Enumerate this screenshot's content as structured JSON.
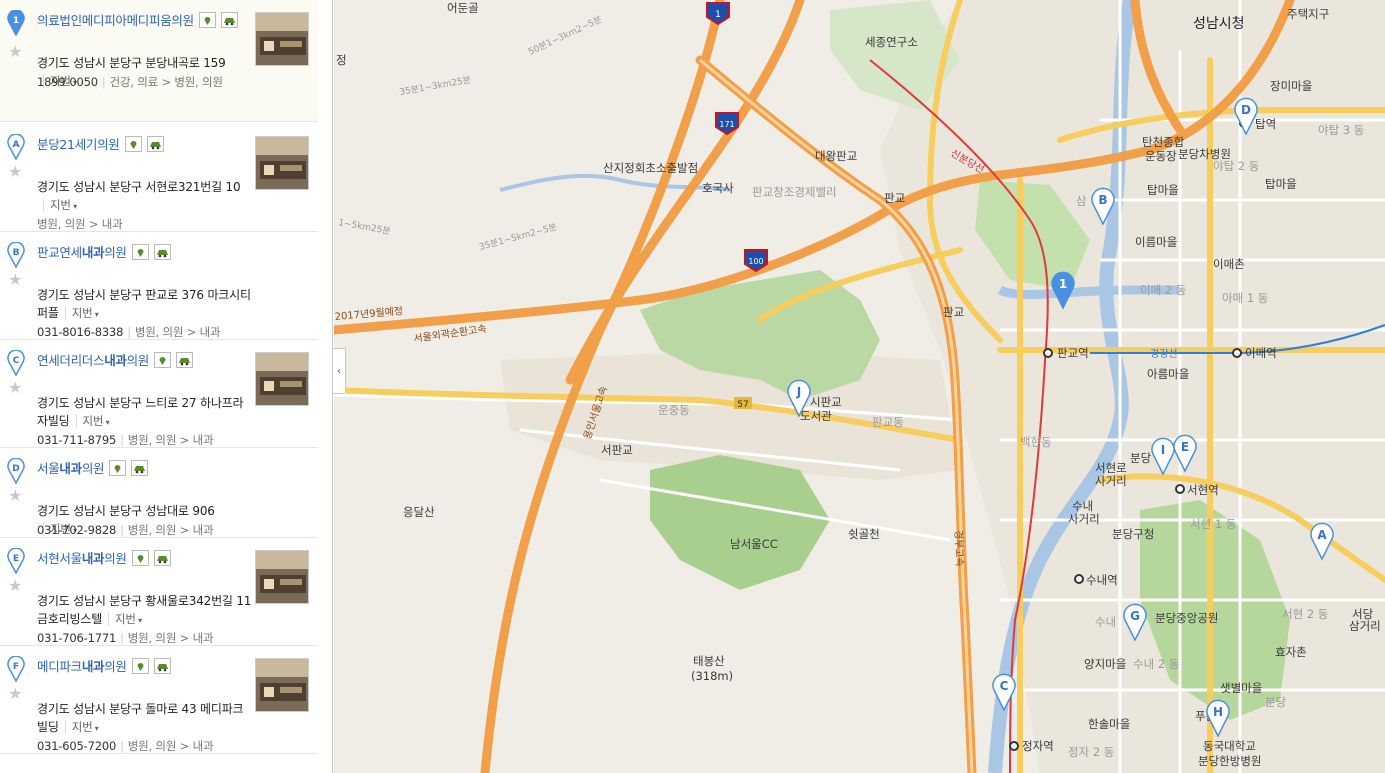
{
  "results": [
    {
      "marker": "1",
      "name": "의료법인메디피아메디피움의원",
      "name_pre": "",
      "name_bold": "",
      "name_post": "",
      "address": "경기도 성남시 분당구 분당내곡로 159",
      "jibeon": "지번",
      "phone": "1899-0050",
      "category": "건강, 의료",
      "subcategory": "병원, 의원",
      "active": true
    },
    {
      "marker": "A",
      "name": "",
      "name_pre": "분당21세기의원",
      "name_bold": "",
      "name_post": "",
      "address": "경기도 성남시 분당구 서현로321번길 10",
      "jibeon": "지번",
      "phone": "",
      "category": "병원, 의원",
      "subcategory": "내과"
    },
    {
      "marker": "B",
      "name": "",
      "name_pre": "판교연세",
      "name_bold": "내과",
      "name_post": "의원",
      "address": "경기도 성남시 분당구 판교로 376 마크시티 퍼플",
      "jibeon": "지번",
      "phone": "031-8016-8338",
      "category": "병원, 의원",
      "subcategory": "내과"
    },
    {
      "marker": "C",
      "name": "",
      "name_pre": "연세더리더스",
      "name_bold": "내과",
      "name_post": "의원",
      "address": "경기도 성남시 분당구 느티로 27 하나프라자빌딩",
      "jibeon": "지번",
      "phone": "031-711-8795",
      "category": "병원, 의원",
      "subcategory": "내과"
    },
    {
      "marker": "D",
      "name": "",
      "name_pre": "서울",
      "name_bold": "내과",
      "name_post": "의원",
      "address": "경기도 성남시 분당구 성남대로 906",
      "jibeon": "지번",
      "phone": "031-702-9828",
      "category": "병원, 의원",
      "subcategory": "내과"
    },
    {
      "marker": "E",
      "name": "",
      "name_pre": "서현서울",
      "name_bold": "내과",
      "name_post": "의원",
      "address": "경기도 성남시 분당구 황새울로342번길 11 금호리빙스텔",
      "jibeon": "지번",
      "phone": "031-706-1771",
      "category": "병원, 의원",
      "subcategory": "내과"
    },
    {
      "marker": "F",
      "name": "",
      "name_pre": "메디파크",
      "name_bold": "내과",
      "name_post": "의원",
      "address": "경기도 성남시 분당구 돌마로 43 메디파크빌딩",
      "jibeon": "지번",
      "phone": "031-605-7200",
      "category": "병원, 의원",
      "subcategory": "내과"
    }
  ],
  "ui": {
    "collapse_arrow": "‹",
    "star": "★"
  },
  "map": {
    "labels": {
      "seongnam_cityhall": "성남시청",
      "judaegu": "주택지구",
      "sejong": "세종연구소",
      "jangmi": "장미마을",
      "tapyeok": "탑역",
      "yatap3": "야탑 3 동",
      "tancheon": "탄천종합",
      "undongjang": "운동장",
      "bundang_cha": "분당차병원",
      "yatap2": "야탑 2 동",
      "tapmaeul": "탑마을",
      "tapmaeul2": "탑마을",
      "sam": "삼",
      "ireum": "이름마을",
      "imae": "이매촌",
      "imae2": "이매 2 동",
      "imae1": "아매 1 동",
      "pangyo_station": "판교역",
      "imae_station": "이매역",
      "gyeonggang": "경강선",
      "ireum2": "아름마을",
      "baekhyeon": "백현동",
      "bundang": "분당",
      "seohyeon_st": "서현역",
      "seohyeon_sageori": "서현로",
      "sageori": "사거리",
      "suwae": "수내",
      "sageori2": "사거리",
      "seohyeon1": "서현 1 동",
      "bundang_gu": "분당구청",
      "sunae_st": "수내역",
      "sunae": "수내",
      "bundang_park": "분당중앙공원",
      "seohyeon2": "서현 2 동",
      "seodang": "서당",
      "sageori3": "삼거리",
      "yangji": "양지마을",
      "sunae2": "수내 2 동",
      "hyoja": "효자촌",
      "saetbyeol": "샛별마을",
      "bundang2": "분당",
      "hansol": "한솔마을",
      "jeongja_st": "정자역",
      "jeongja2": "정자 2 동",
      "dongguk": "동국대학교",
      "bundang_hanbang": "분당한방병원",
      "pu": "푸른",
      "eodun": "어둔골",
      "daewang": "대왕판교",
      "hogosa": "호국사",
      "pangyo_valley": "판교창조경제밸리",
      "pangyo_jc": "판교",
      "pangyo_ic": "판교",
      "sanjijeong": "산지정회초소출발점",
      "undong": "운중동",
      "pangyo_dong": "판교동",
      "seopangyo": "서판교",
      "pangyo_lib": "시판교",
      "pangyo_lib2": "도서관",
      "eungdal": "응달산",
      "namseoul": "남서울CC",
      "swigol": "쉿골천",
      "taebong": "태봉산",
      "taebong_h": "(318m)",
      "route57": "57",
      "seoul_ring": "서울외곽순환고속",
      "yongin_seoul": "용인서울고속",
      "gyeongbu": "경부고속",
      "shinbundang": "신분당선",
      "cnt": "2017년9월예정",
      "contour1": "50분1~3km2~5분",
      "contour2": "35분1~3km25분",
      "contour3": "1~5km25분",
      "contour4": "35분1~5km2~5분",
      "jeong": "정",
      "rt1": "1",
      "rt171": "171",
      "rt100": "100",
      "mk1": "1",
      "mkA": "A",
      "mkB": "B",
      "mkC": "C",
      "mkD": "D",
      "mkE": "E",
      "mkG": "G",
      "mkH": "H",
      "mkI": "I",
      "mkJ": "J"
    }
  }
}
